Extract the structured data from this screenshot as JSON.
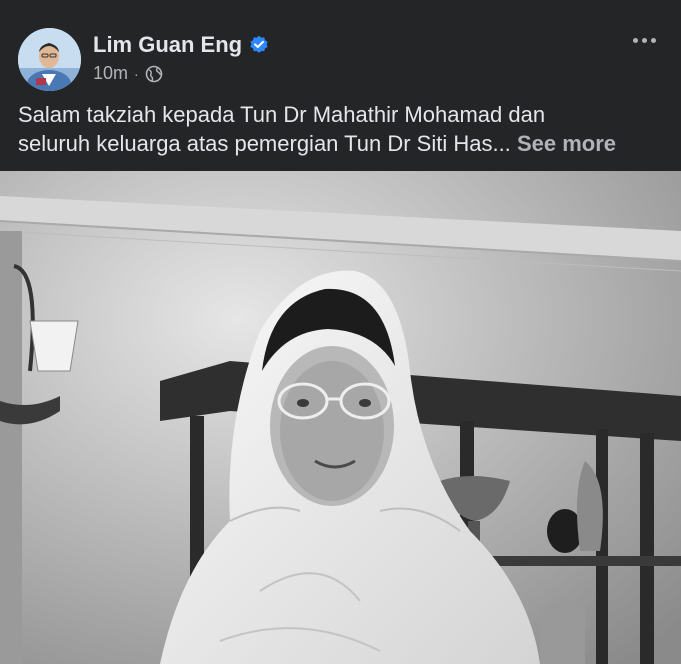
{
  "post": {
    "author": "Lim Guan Eng",
    "verified": true,
    "timestamp": "10m",
    "separator": "·",
    "audience_icon": "globe-icon",
    "more_icon": "more-options-icon",
    "text_line1": "Salam takziah kepada Tun Dr Mahathir Mohamad dan",
    "text_line2": "seluruh keluarga atas pemergian Tun Dr Siti Has...",
    "see_more": "See more"
  },
  "colors": {
    "background": "#242526",
    "text_primary": "#e4e6eb",
    "text_secondary": "#b0b3b8",
    "verified_badge": "#2d88ff"
  }
}
